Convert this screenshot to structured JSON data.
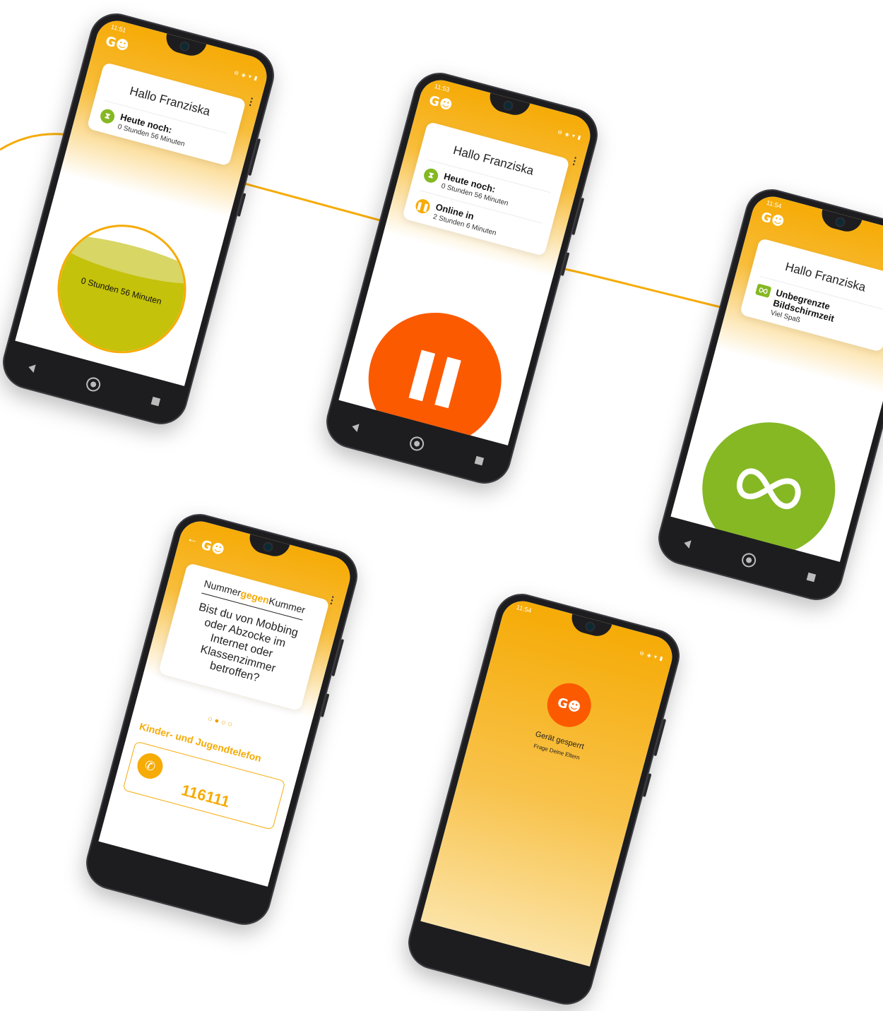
{
  "colors": {
    "brand_orange": "#f6ab06",
    "pause_orange": "#fb5a00",
    "unlimited_green": "#85b823",
    "timer_green": "#c4c20a"
  },
  "app": {
    "logo": "G☻"
  },
  "phone1": {
    "status_time": "11:51",
    "status_icons": "⊖ ◈ ▾ ▮",
    "greeting": "Hallo Franziska",
    "remaining_title": "Heute noch:",
    "remaining_value": "0 Stunden 56 Minuten",
    "timer_label": "0 Stunden 56 Minuten",
    "remaining_fraction": 0.78
  },
  "phone2": {
    "status_time": "11:53",
    "status_icons": "⊖ ◈ ▾ ▮",
    "greeting": "Hallo Franziska",
    "remaining_title": "Heute noch:",
    "remaining_value": "0 Stunden 56 Minuten",
    "online_title": "Online in",
    "online_value": "2 Stunden 6 Minuten"
  },
  "phone3": {
    "status_time": "11:54",
    "greeting": "Hallo Franziska",
    "unlimited_title": "Unbegrenzte Bildschirmzeit",
    "unlimited_sub": "Viel Spaß"
  },
  "phone4": {
    "logo_part1": "Nummer",
    "logo_part2": "gegen",
    "logo_part3": "Kummer",
    "question": "Bist du von Mobbing oder Abzocke im Internet oder Klassenzimmer betroffen?",
    "dots": "○●○○",
    "section_title": "Kinder- und Jugendtelefon",
    "phone_number": "116111"
  },
  "phone5": {
    "status_time": "11:54",
    "status_icons": "⊖ ◈ ▾ ▮",
    "locked_title": "Gerät gesperrt",
    "locked_sub": "Frage Deine Eltern"
  }
}
